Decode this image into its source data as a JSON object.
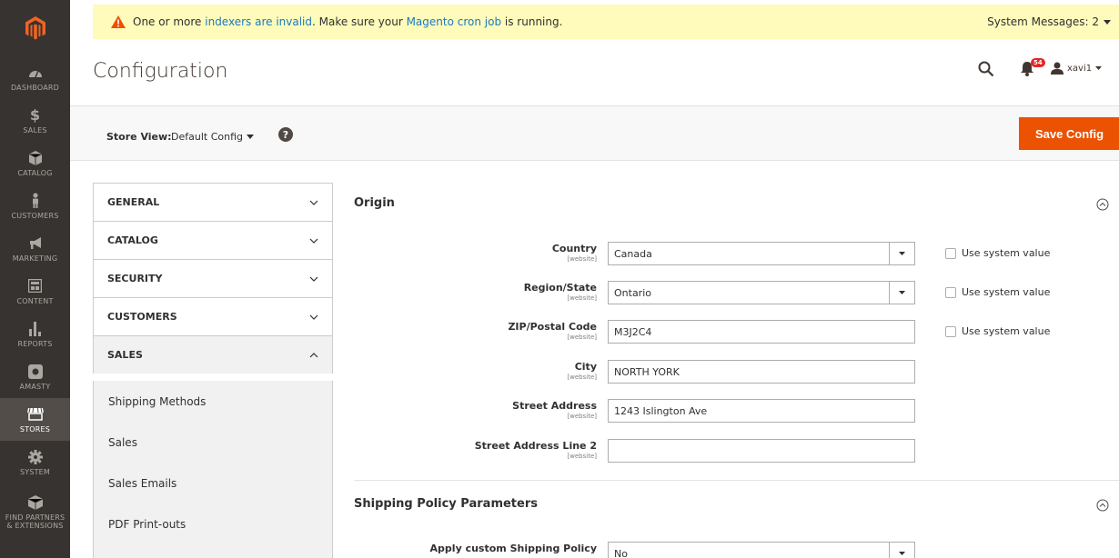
{
  "sidebar": {
    "items": [
      {
        "label": "DASHBOARD",
        "icon": "dashboard-icon"
      },
      {
        "label": "SALES",
        "icon": "dollar-icon"
      },
      {
        "label": "CATALOG",
        "icon": "box-icon"
      },
      {
        "label": "CUSTOMERS",
        "icon": "person-icon"
      },
      {
        "label": "MARKETING",
        "icon": "megaphone-icon"
      },
      {
        "label": "CONTENT",
        "icon": "content-icon"
      },
      {
        "label": "REPORTS",
        "icon": "bar-chart-icon"
      },
      {
        "label": "AMASTY",
        "icon": "amasty-icon"
      },
      {
        "label": "STORES",
        "icon": "store-icon"
      },
      {
        "label": "SYSTEM",
        "icon": "gear-icon"
      },
      {
        "label": "FIND PARTNERS & EXTENSIONS",
        "icon": "partners-icon"
      }
    ],
    "active": "STORES"
  },
  "system_message": {
    "prefix": "One or more ",
    "link1": "indexers are invalid",
    "middle": ". Make sure your ",
    "link2": "Magento cron job",
    "suffix": " is running.",
    "counter": "System Messages: 2"
  },
  "header": {
    "title": "Configuration",
    "notification_count": "54",
    "username": "xavi1"
  },
  "store_view": {
    "label": "Store View:",
    "value": "Default Config",
    "save_label": "Save Config"
  },
  "tabs": [
    {
      "label": "GENERAL",
      "open": false
    },
    {
      "label": "CATALOG",
      "open": false
    },
    {
      "label": "SECURITY",
      "open": false
    },
    {
      "label": "CUSTOMERS",
      "open": false
    },
    {
      "label": "SALES",
      "open": true
    }
  ],
  "sales_subnav": [
    "Shipping Methods",
    "Sales",
    "Sales Emails",
    "PDF Print-outs"
  ],
  "origin": {
    "title": "Origin",
    "fields": [
      {
        "label": "Country",
        "scope": "[website]",
        "value": "Canada",
        "type": "select",
        "use_system": "Use system value"
      },
      {
        "label": "Region/State",
        "scope": "[website]",
        "value": "Ontario",
        "type": "select",
        "use_system": "Use system value"
      },
      {
        "label": "ZIP/Postal Code",
        "scope": "[website]",
        "value": "M3J2C4",
        "type": "text",
        "use_system": "Use system value"
      },
      {
        "label": "City",
        "scope": "[website]",
        "value": "NORTH YORK",
        "type": "text"
      },
      {
        "label": "Street Address",
        "scope": "[website]",
        "value": "1243 Islington Ave",
        "type": "text"
      },
      {
        "label": "Street Address Line 2",
        "scope": "[website]",
        "value": "",
        "type": "text"
      }
    ]
  },
  "shipping_policy": {
    "title": "Shipping Policy Parameters",
    "fields": [
      {
        "label": "Apply custom Shipping Policy",
        "value": "No",
        "type": "select"
      }
    ]
  }
}
